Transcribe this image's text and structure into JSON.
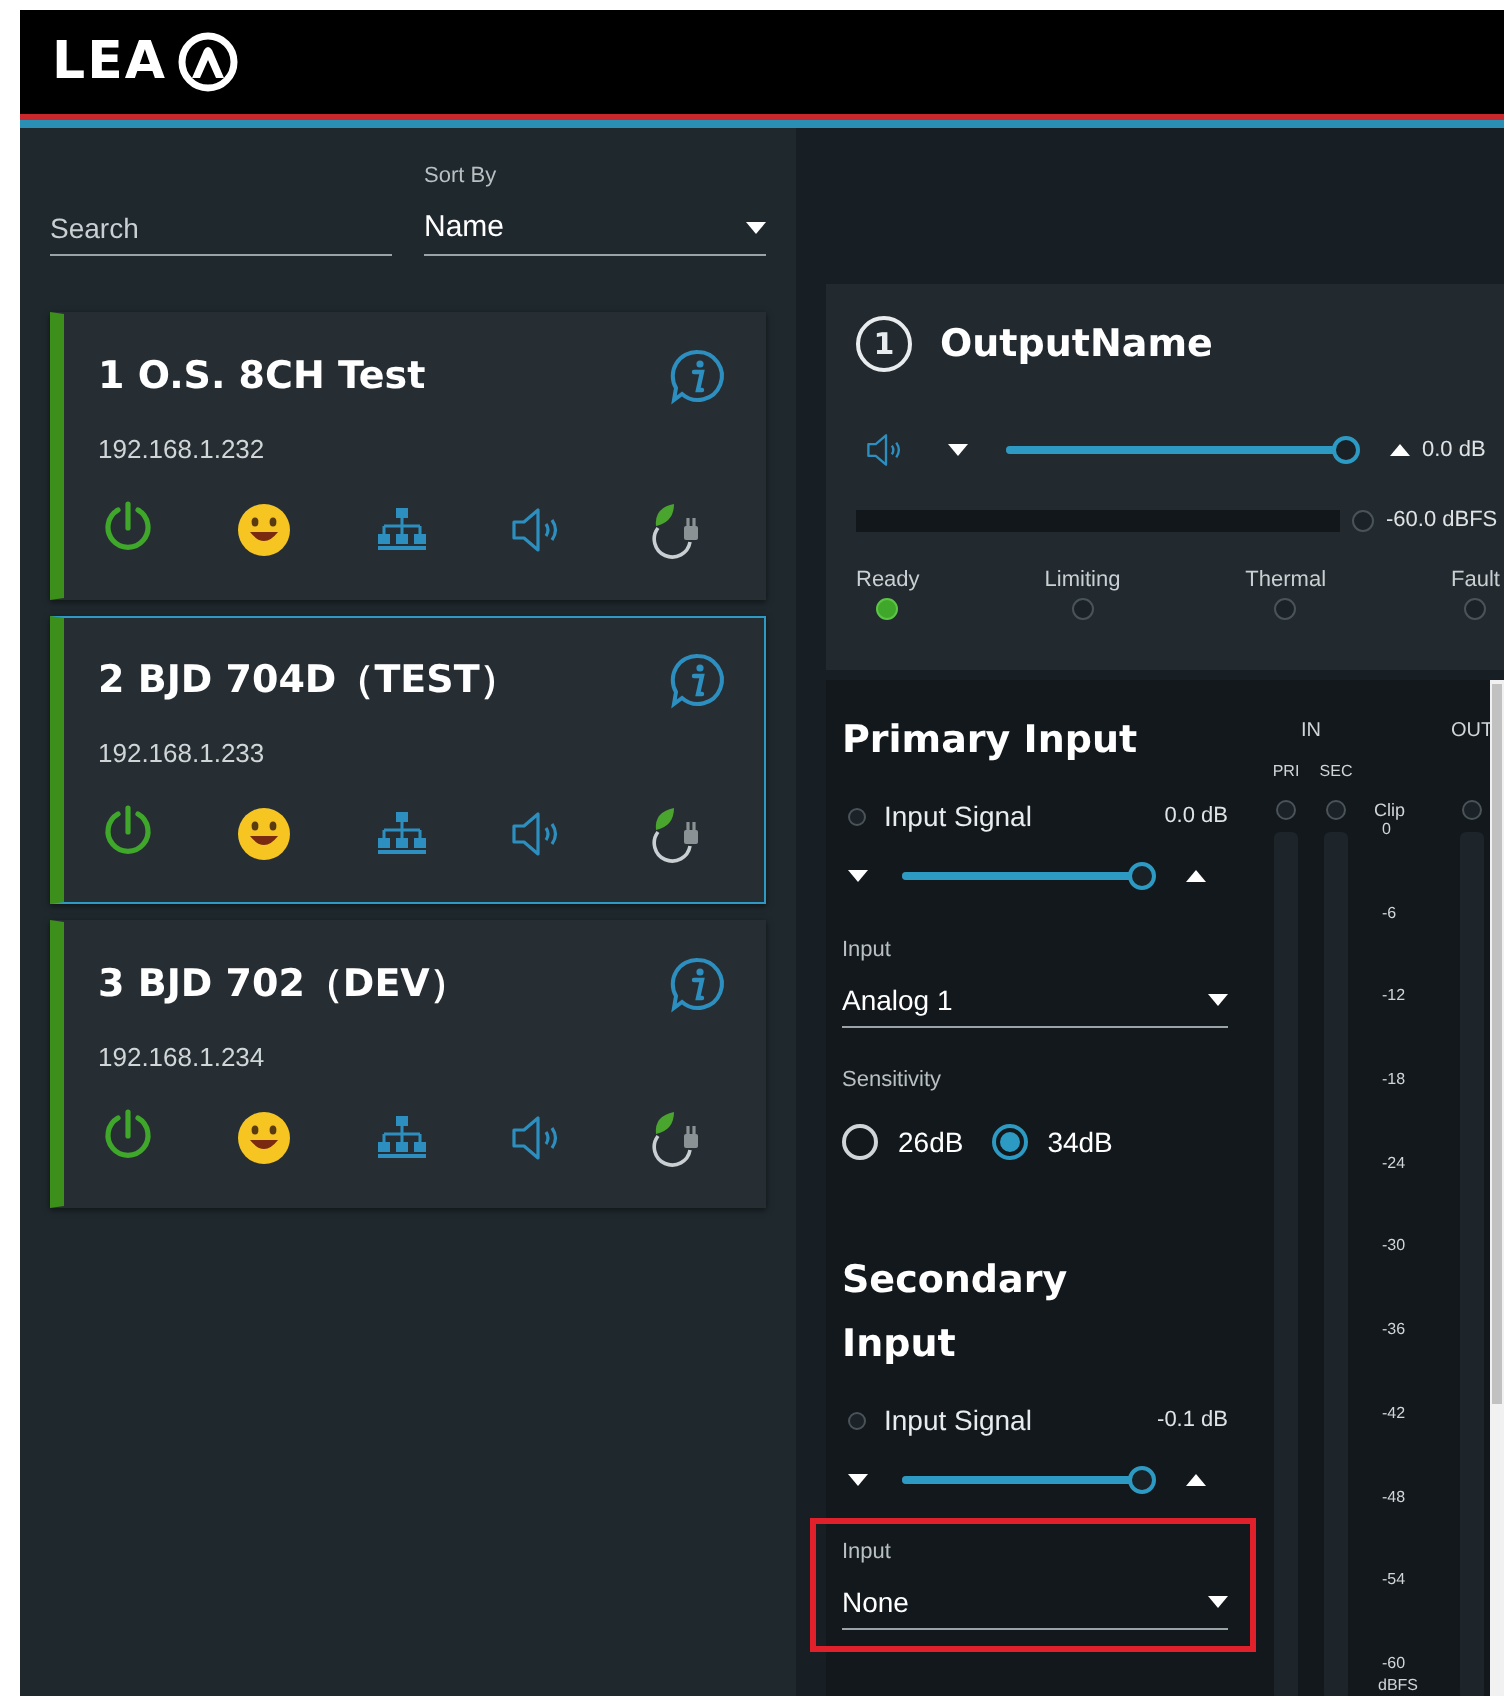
{
  "header": {
    "logo": "LEA"
  },
  "sidebar": {
    "search": {
      "placeholder": "Search"
    },
    "sort": {
      "label": "Sort By",
      "value": "Name"
    },
    "devices": [
      {
        "name": "1 O.S. 8CH Test",
        "ip": "192.168.1.232",
        "selected": false
      },
      {
        "name": "2 BJD 704D（TEST）",
        "ip": "192.168.1.233",
        "selected": true
      },
      {
        "name": "3 BJD 702（DEV）",
        "ip": "192.168.1.234",
        "selected": false
      }
    ]
  },
  "output": {
    "number": "1",
    "name": "OutputName",
    "volume": {
      "level": 1,
      "reading": "0.0 dB"
    },
    "meter": {
      "level": 0,
      "reading": "-60.0 dBFS"
    },
    "status": [
      {
        "label": "Ready",
        "on": true
      },
      {
        "label": "Limiting",
        "on": false
      },
      {
        "label": "Thermal",
        "on": false
      },
      {
        "label": "Fault",
        "on": false
      }
    ]
  },
  "inputs": [
    {
      "title": "Primary Input",
      "signal": {
        "label": "Input Signal",
        "on": false,
        "reading": "0.0 dB"
      },
      "gain": {
        "level": 1
      },
      "source": {
        "label": "Input",
        "value": "Analog 1",
        "highlighted": false
      },
      "sensitivity": {
        "label": "Sensitivity",
        "options": [
          {
            "label": "26dB",
            "selected": false
          },
          {
            "label": "34dB",
            "selected": true
          }
        ]
      }
    },
    {
      "title": "Secondary Input",
      "signal": {
        "label": "Input Signal",
        "on": false,
        "reading": "-0.1 dB"
      },
      "gain": {
        "level": 1
      },
      "source": {
        "label": "Input",
        "value": "None",
        "highlighted": true
      }
    }
  ],
  "meters": {
    "in_label": "IN",
    "out_label": "OUT",
    "clip_label": "Clip",
    "unit": "dBFS",
    "channels": [
      {
        "label": "PRI",
        "clip": false,
        "level": 0
      },
      {
        "label": "SEC",
        "clip": false,
        "level": 0
      }
    ],
    "out": {
      "clip": false,
      "level": 0
    },
    "scale": [
      "0",
      "-6",
      "-12",
      "-18",
      "-24",
      "-30",
      "-36",
      "-42",
      "-48",
      "-54",
      "-60"
    ]
  }
}
